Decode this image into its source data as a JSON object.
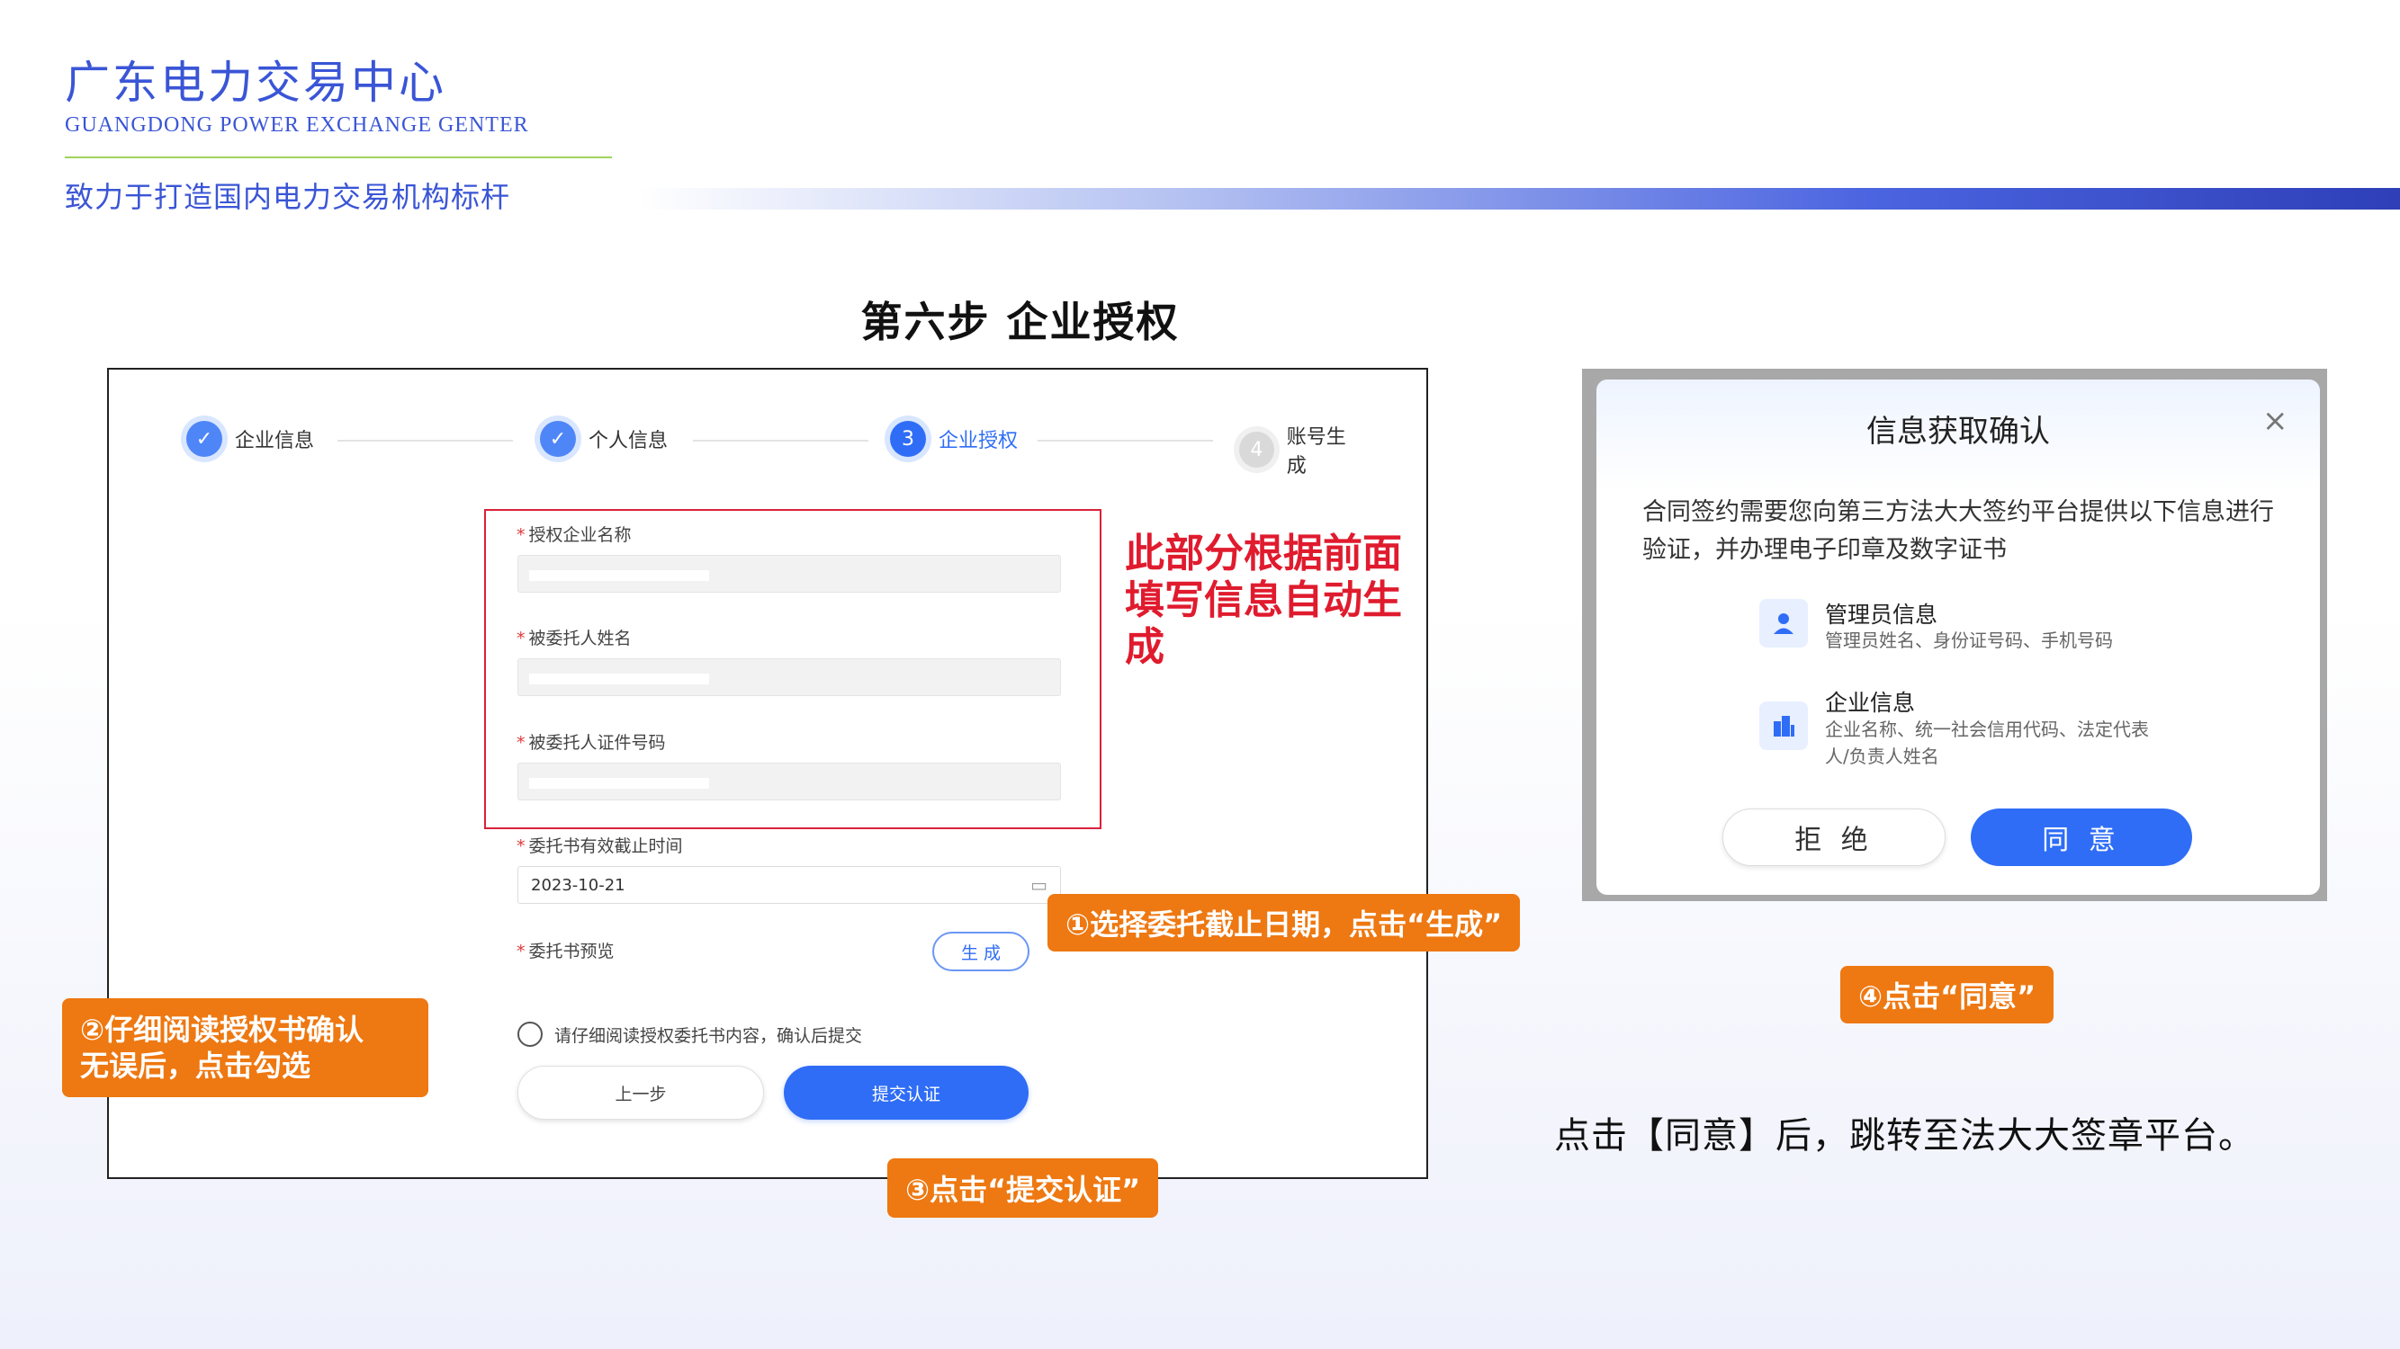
{
  "header": {
    "org_name_cn": "广东电力交易中心",
    "org_name_en": "GUANGDONG POWER EXCHANGE GENTER",
    "slogan": "致力于打造国内电力交易机构标杆"
  },
  "step_title": "第六步  企业授权",
  "stepper": [
    {
      "label": "企业信息",
      "state": "done",
      "marker": "✓"
    },
    {
      "label": "个人信息",
      "state": "done",
      "marker": "✓"
    },
    {
      "label": "企业授权",
      "state": "current",
      "marker": "3"
    },
    {
      "label": "账号生成",
      "state": "todo",
      "marker": "4"
    }
  ],
  "form": {
    "fields": [
      {
        "label": "授权企业名称"
      },
      {
        "label": "被委托人姓名"
      },
      {
        "label": "被委托人证件号码"
      }
    ],
    "date_label": "委托书有效截止时间",
    "date_value": "2023-10-21",
    "preview_label": "委托书预览",
    "generate_button": "生 成",
    "agree_text": "请仔细阅读授权委托书内容，确认后提交",
    "prev_button": "上一步",
    "submit_button": "提交认证"
  },
  "red_note": "此部分根据前面填写信息自动生成",
  "callouts": {
    "c1": "①选择委托截止日期，点击“生成”",
    "c2_line1": "②仔细阅读授权书确认",
    "c2_line2": "无误后，点击勾选",
    "c3": "③点击“提交认证”",
    "c4": "④点击“同意”"
  },
  "dialog": {
    "title": "信息获取确认",
    "close": "×",
    "body": "合同签约需要您向第三方法大大签约平台提供以下信息进行验证，并办理电子印章及数字证书",
    "items": [
      {
        "title": "管理员信息",
        "desc": "管理员姓名、身份证号码、手机号码",
        "icon": "user-icon"
      },
      {
        "title": "企业信息",
        "desc": "企业名称、统一社会信用代码、法定代表人/负责人姓名",
        "icon": "building-icon"
      }
    ],
    "reject_button": "拒 绝",
    "agree_button": "同 意"
  },
  "final_text": "点击【同意】后，跳转至法大大签章平台。",
  "colors": {
    "brand_blue": "#3a55d6",
    "primary_button": "#2f6df6",
    "callout_orange": "#ee7811",
    "note_red": "#e01b2e"
  }
}
